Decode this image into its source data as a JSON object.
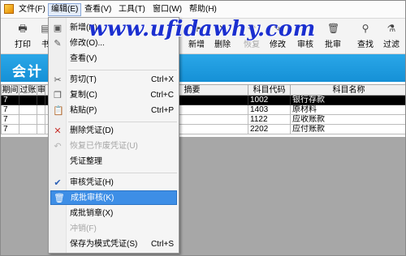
{
  "menubar": {
    "items": [
      {
        "label": "文件(F)"
      },
      {
        "label": "编辑(E)"
      },
      {
        "label": "查看(V)"
      },
      {
        "label": "工具(T)"
      },
      {
        "label": "窗口(W)"
      },
      {
        "label": "帮助(H)"
      }
    ]
  },
  "toolbar": {
    "buttons": [
      {
        "label": "打印",
        "icon": "printer-icon"
      },
      {
        "label": "书",
        "icon": "book-icon"
      },
      {
        "label": "新增",
        "icon": "new-icon"
      },
      {
        "label": "删除",
        "icon": "delete-icon"
      },
      {
        "label": "恢复",
        "icon": "restore-icon"
      },
      {
        "label": "修改",
        "icon": "edit-icon"
      },
      {
        "label": "审核",
        "icon": "audit-icon"
      },
      {
        "label": "批审",
        "icon": "batch-audit-icon"
      },
      {
        "label": "查找",
        "icon": "find-icon"
      },
      {
        "label": "过滤",
        "icon": "filter-icon"
      }
    ]
  },
  "band": {
    "title": "会计"
  },
  "watermark": "www.ufidawhy.com",
  "grid": {
    "columns": [
      "期间",
      "过账",
      "审",
      "",
      "摘要",
      "科目代码",
      "科目名称"
    ],
    "rows": [
      {
        "period": "7",
        "code": "1002",
        "name": "银行存款",
        "selected": true
      },
      {
        "period": "7",
        "code": "1403",
        "name": "原材料"
      },
      {
        "period": "7",
        "code": "1122",
        "name": "应收账款"
      },
      {
        "period": "7",
        "code": "2202",
        "name": "应付账款"
      }
    ]
  },
  "edit_menu": {
    "items": [
      {
        "label": "新增(N)",
        "shortcut": "",
        "icon": "new-icon"
      },
      {
        "label": "修改(O)...",
        "shortcut": "",
        "icon": "edit-icon"
      },
      {
        "label": "查看(V)",
        "shortcut": ""
      },
      {
        "label": "剪切(T)",
        "shortcut": "Ctrl+X",
        "icon": "cut-icon"
      },
      {
        "label": "复制(C)",
        "shortcut": "Ctrl+C",
        "icon": "copy-icon"
      },
      {
        "label": "粘贴(P)",
        "shortcut": "Ctrl+P",
        "icon": "paste-icon"
      },
      {
        "label": "删除凭证(D)",
        "shortcut": "",
        "icon": "delete-icon"
      },
      {
        "label": "恢复已作废凭证(U)",
        "shortcut": "",
        "icon": "undo-icon"
      },
      {
        "label": "凭证整理",
        "shortcut": ""
      },
      {
        "label": "审核凭证(H)",
        "shortcut": "",
        "icon": "audit-icon"
      },
      {
        "label": "成批审核(K)",
        "shortcut": "",
        "icon": "trash-icon"
      },
      {
        "label": "成批销章(X)",
        "shortcut": ""
      },
      {
        "label": "冲销(F)",
        "shortcut": ""
      },
      {
        "label": "保存为模式凭证(S)",
        "shortcut": "Ctrl+S"
      }
    ]
  }
}
